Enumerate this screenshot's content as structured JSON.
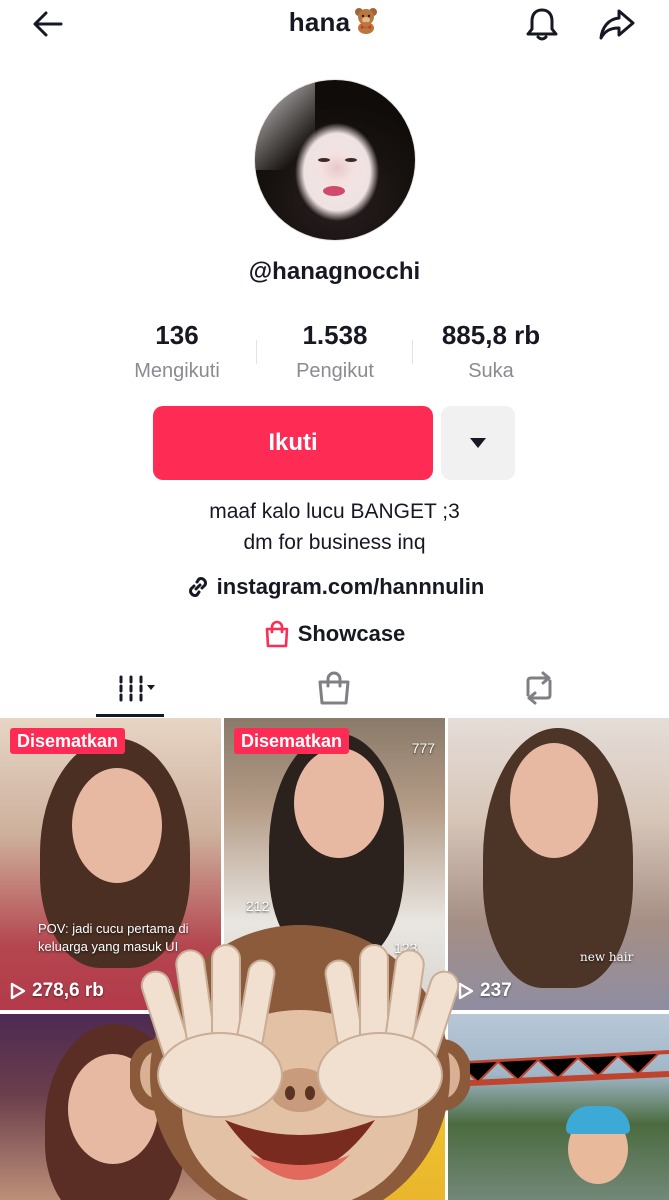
{
  "header": {
    "title": "hana",
    "back_icon": "arrow-left-icon",
    "bell_icon": "bell-icon",
    "share_icon": "share-icon"
  },
  "profile": {
    "username": "@hanagnocchi",
    "stats": [
      {
        "value": "136",
        "label": "Mengikuti"
      },
      {
        "value": "1.538",
        "label": "Pengikut"
      },
      {
        "value": "885,8 rb",
        "label": "Suka"
      }
    ],
    "follow_label": "Ikuti",
    "bio_lines": [
      "maaf kalo lucu BANGET ;3",
      "dm for business inq"
    ],
    "link": "instagram.com/hannnulin",
    "showcase": "Showcase"
  },
  "tabs": [
    {
      "icon": "grid-icon",
      "active": true
    },
    {
      "icon": "shopping-bag-icon",
      "active": false
    },
    {
      "icon": "repost-icon",
      "active": false
    }
  ],
  "videos": [
    {
      "pinned": "Disematkan",
      "views": "278,6 rb",
      "overlay": "POV: jadi cucu pertama di keluarga yang masuk UI"
    },
    {
      "pinned": "Disematkan",
      "overlay_top": "777",
      "overlay_mid": "212",
      "overlay_bottom": "123"
    },
    {
      "views": "237",
      "overlay": "new hair"
    },
    {},
    {},
    {}
  ],
  "colors": {
    "accent": "#fe2c55",
    "text": "#161823",
    "muted": "#8a8b91",
    "secondary_button": "#f1f1f2"
  }
}
